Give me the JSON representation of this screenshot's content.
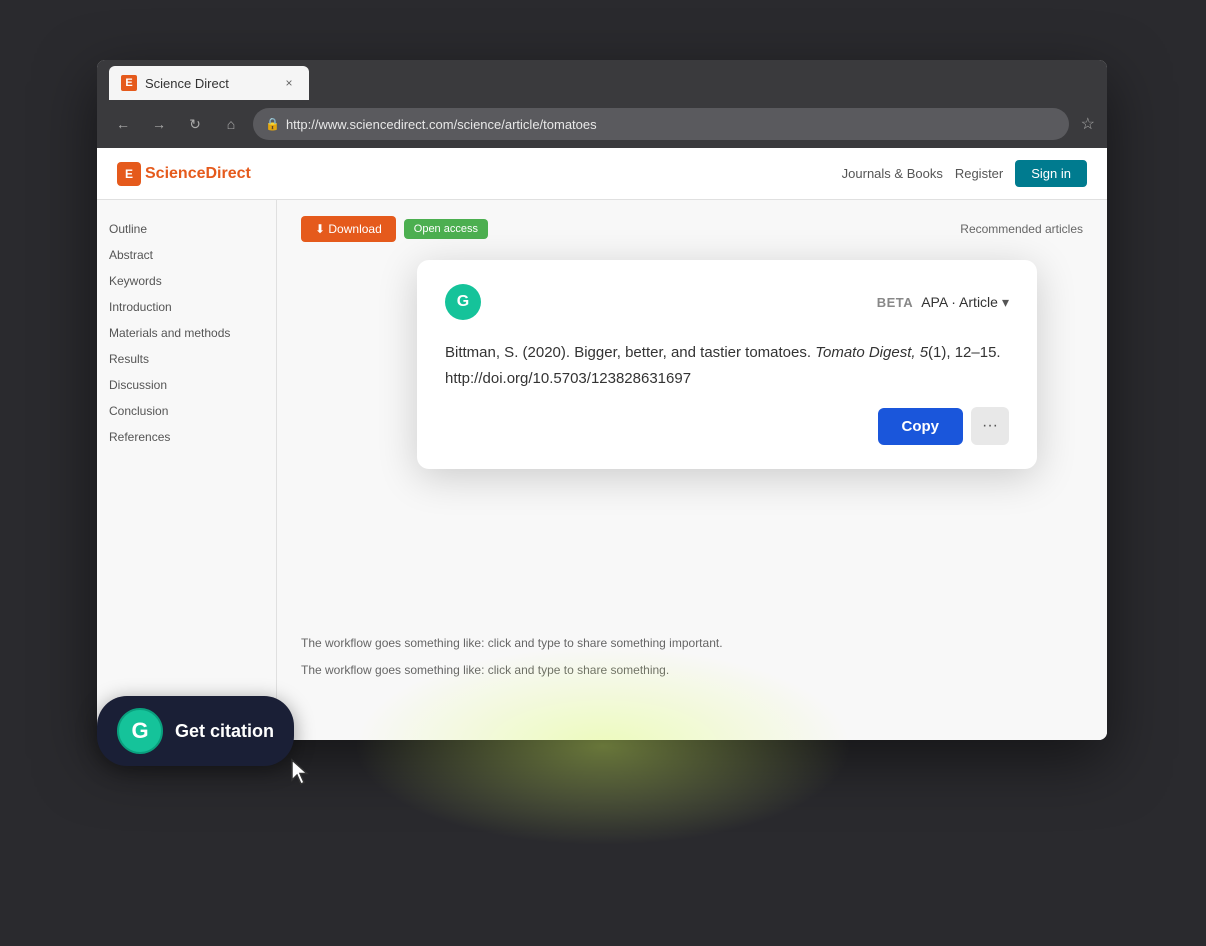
{
  "browser": {
    "tab": {
      "favicon_letter": "E",
      "title": "Science Direct",
      "close_label": "×"
    },
    "nav": {
      "back_label": "←",
      "forward_label": "→",
      "refresh_label": "↻",
      "home_label": "⌂",
      "url": "http://www.sciencedirect.com/science/article/tomatoes",
      "star_label": "☆"
    }
  },
  "sciencedirect": {
    "logo_letter": "E",
    "logo_text": "ScienceDirect",
    "nav_links": [
      "Journals & Books",
      "Register",
      "Sign in"
    ],
    "register_label": "Sign in",
    "access_label": "Recommended articles"
  },
  "sidebar": {
    "items": [
      {
        "label": "Outline"
      },
      {
        "label": "Abstract"
      },
      {
        "label": "Keywords"
      },
      {
        "label": "Introduction"
      },
      {
        "label": "Materials and methods"
      },
      {
        "label": "Results"
      },
      {
        "label": "Discussion"
      },
      {
        "label": "Conclusion"
      },
      {
        "label": "References"
      }
    ]
  },
  "article": {
    "download_label": "⬇ Download",
    "access_badge": "Open access",
    "article_body_1": "The workflow goes something like: click and type to share something important.",
    "article_body_2": "The workflow goes something like: click and type to share something."
  },
  "citation_popup": {
    "grammarly_letter": "G",
    "beta_label": "BETA",
    "style_label": "APA · Article",
    "chevron": "▾",
    "citation_text_before_italic": "Bittman, S. (2020). Bigger, better, and tastier tomatoes. ",
    "citation_italic": "Tomato Digest, 5",
    "citation_text_after_italic": "(1), 12–15.",
    "citation_doi": "http://doi.org/10.5703/123828631697",
    "copy_label": "Copy",
    "more_label": "···"
  },
  "get_citation_btn": {
    "g_letter": "G",
    "label": "Get citation"
  }
}
